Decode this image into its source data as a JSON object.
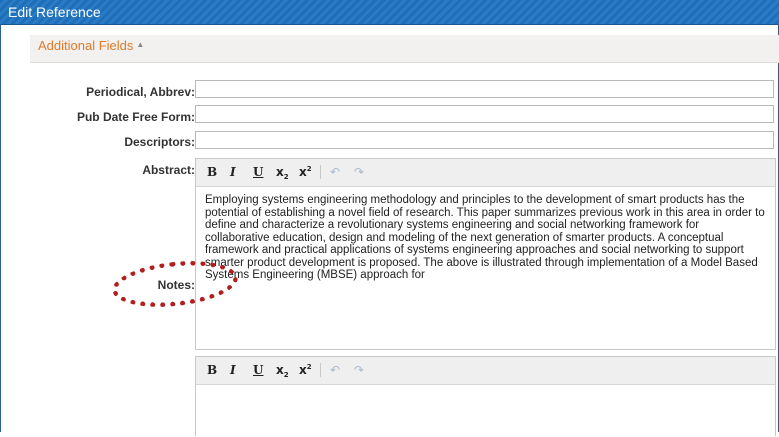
{
  "window": {
    "title": "Edit Reference"
  },
  "section": {
    "title": "Additional Fields",
    "toggle_icon": "caret-up-icon"
  },
  "fields": {
    "periodical_label": "Periodical, Abbrev:",
    "periodical_value": "",
    "pubdate_label": "Pub Date Free Form:",
    "pubdate_value": "",
    "descriptors_label": "Descriptors:",
    "descriptors_value": "",
    "abstract_label": "Abstract:",
    "notes_label": "Notes:"
  },
  "toolbar": {
    "bold": "B",
    "italic": "I",
    "underline": "U",
    "subscript": "x",
    "superscript": "x",
    "undo": "↶",
    "redo": "↷"
  },
  "abstract": {
    "text": "Employing systems engineering methodology and principles to the development of smart products has the potential of establishing a novel field of research. This paper summarizes previous work in this area in order to define and characterize a revolutionary systems engineering and social networking framework for collaborative education, design and modeling of the next generation of smarter products. A conceptual framework and practical applications of systems engineering approaches and social networking to support smarter product development is proposed. The above is illustrated through implementation of a Model Based Systems Engineering (MBSE) approach for"
  },
  "notes": {
    "text": ""
  },
  "colors": {
    "title_bar": "#1f6fb8",
    "section_title": "#e07a2a",
    "callout": "#b21f1f"
  }
}
